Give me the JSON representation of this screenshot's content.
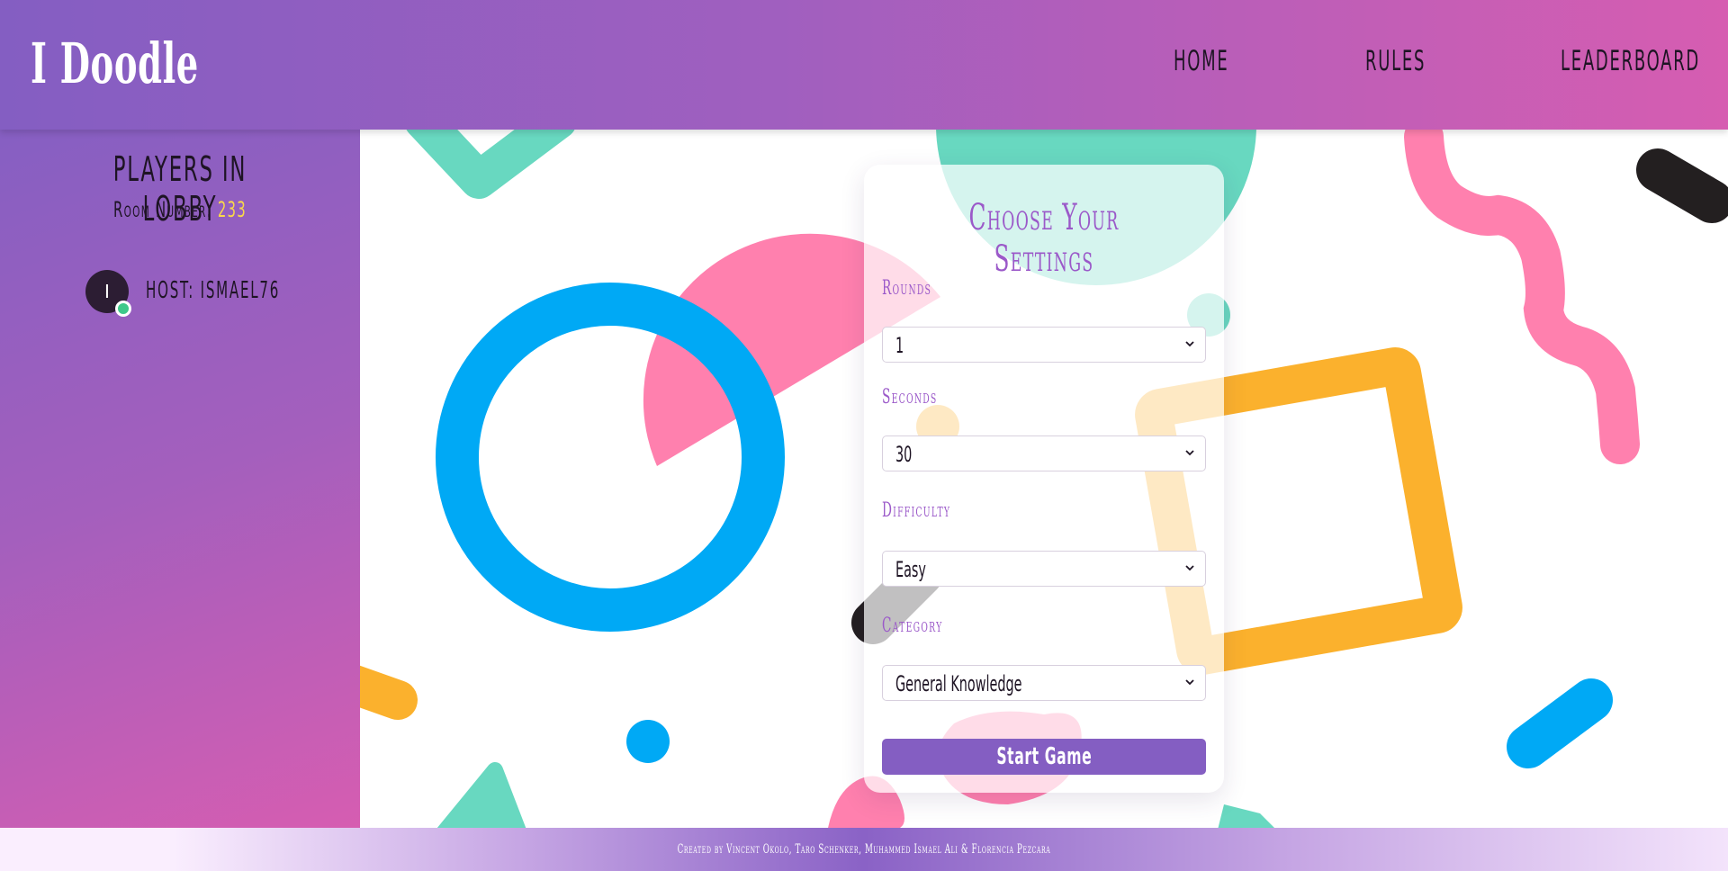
{
  "header": {
    "logo": "I Doodle",
    "nav": {
      "home": "HOME",
      "rules": "RULES",
      "leaderboard": "LEADERBOARD"
    }
  },
  "sidebar": {
    "title": "PLAYERS IN LOBBY",
    "room_label": "Room Number:",
    "room_number": "233",
    "players": [
      {
        "initial": "I",
        "label": "HOST: ISMAEL76",
        "status": "online"
      }
    ]
  },
  "settings": {
    "title": "Choose Your Settings",
    "rounds": {
      "label": "Rounds",
      "value": "1"
    },
    "seconds": {
      "label": "Seconds",
      "value": "30"
    },
    "difficulty": {
      "label": "Difficulty",
      "value": "Easy"
    },
    "category": {
      "label": "Category",
      "value": "General Knowledge"
    },
    "start_label": "Start Game"
  },
  "footer": {
    "credit": "Created by Vincent Okolo, Taro Schenker, Muhammed Ismael Ali & Florencia Pezcara"
  },
  "colors": {
    "header_start": "#845ec2",
    "header_end": "#d65db1",
    "accent_purple": "#845ec2",
    "teal": "#68d8c0",
    "pink": "#ff80ae",
    "blue": "#00a9f5",
    "yellow": "#fbb12d",
    "dark": "#231f20",
    "online": "#3ec98a",
    "room_number": "#f9d84a"
  }
}
